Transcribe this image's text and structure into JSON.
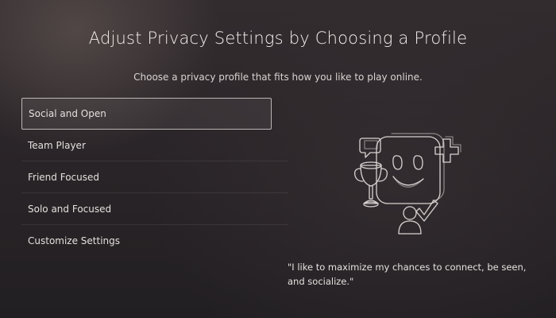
{
  "header": {
    "title": "Adjust Privacy Settings by Choosing a Profile",
    "subtitle": "Choose a privacy profile that fits how you like to play online."
  },
  "profiles": [
    {
      "label": "Social and Open",
      "selected": true
    },
    {
      "label": "Team Player",
      "selected": false
    },
    {
      "label": "Friend Focused",
      "selected": false
    },
    {
      "label": "Solo and Focused",
      "selected": false
    },
    {
      "label": "Customize Settings",
      "selected": false
    }
  ],
  "illustration": {
    "icons": [
      "chat-bubble-icon",
      "trophy-icon",
      "smiley-face-icon",
      "plus-icon",
      "person-icon",
      "checkmark-icon"
    ]
  },
  "description": {
    "quote": "\"I like to maximize my chances to connect, be seen, and socialize.\""
  },
  "colors": {
    "background": "#2a2528",
    "text": "#e9e6e3",
    "selection_border": "#e6e2de"
  }
}
